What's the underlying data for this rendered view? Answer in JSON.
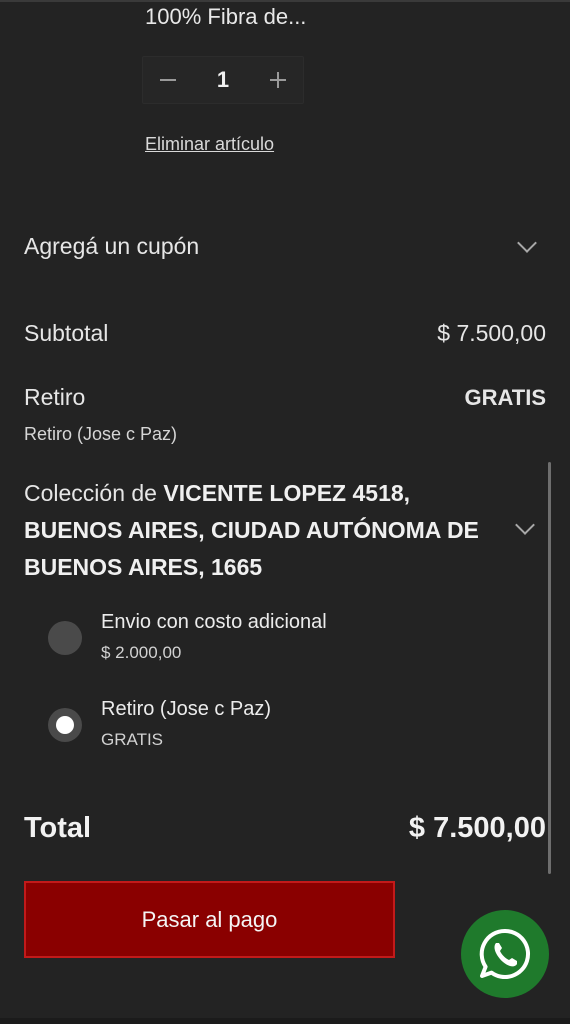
{
  "product": {
    "name": "100% Fibra de...",
    "quantity": "1",
    "minus_icon": "minus-icon",
    "plus_icon": "plus-icon",
    "remove_label": "Eliminar artículo"
  },
  "coupon": {
    "label": "Agregá un cupón",
    "icon": "chevron-down-icon"
  },
  "subtotal": {
    "label": "Subtotal",
    "value": "$ 7.500,00"
  },
  "pickup": {
    "label": "Retiro",
    "value": "GRATIS",
    "detail": "Retiro (Jose c Paz)"
  },
  "collection": {
    "prefix": "Colección de ",
    "address": "VICENTE LOPEZ 4518, BUENOS AIRES, CIUDAD AUTÓNOMA DE BUENOS AIRES, 1665",
    "icon": "chevron-down-icon"
  },
  "shipping_options": [
    {
      "title": "Envio con costo adicional",
      "price": "$ 2.000,00",
      "selected": false
    },
    {
      "title": "Retiro (Jose c Paz)",
      "price": "GRATIS",
      "selected": true
    }
  ],
  "total": {
    "label": "Total",
    "value": "$ 7.500,00"
  },
  "checkout": {
    "label": "Pasar al pago"
  },
  "whatsapp": {
    "icon": "whatsapp-icon"
  },
  "colors": {
    "background": "#232323",
    "button": "#8a0000",
    "button_border": "#c21a1a",
    "whatsapp": "#1f7a2c"
  }
}
